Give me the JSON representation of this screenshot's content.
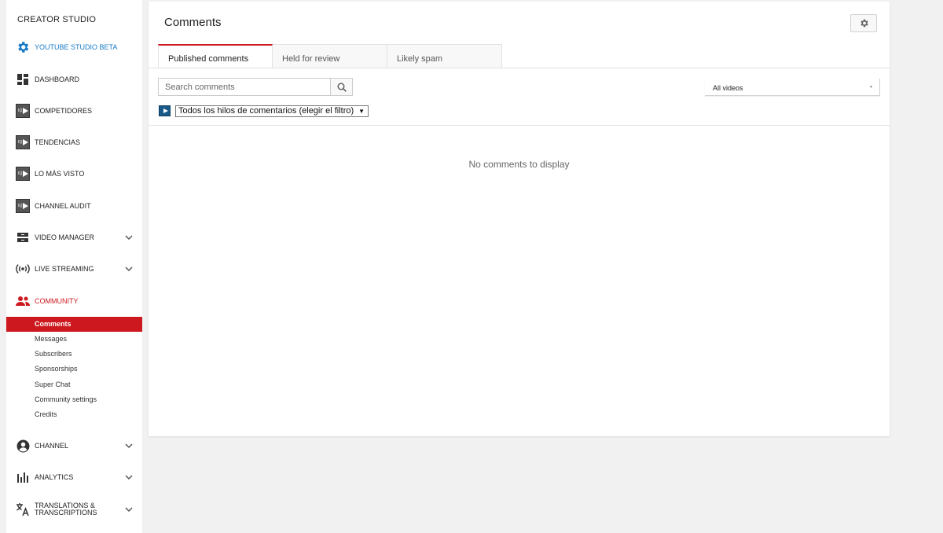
{
  "sidebar": {
    "brand": "CREATOR STUDIO",
    "items": [
      {
        "label": "YOUTUBE STUDIO BETA",
        "icon": "gear-icon"
      },
      {
        "label": "DASHBOARD",
        "icon": "dashboard-icon"
      },
      {
        "label": "COMPETIDORES",
        "icon": "vidiq-icon"
      },
      {
        "label": "TENDENCIAS",
        "icon": "vidiq-icon"
      },
      {
        "label": "LO MÁS VISTO",
        "icon": "vidiq-icon"
      },
      {
        "label": "CHANNEL AUDIT",
        "icon": "vidiq-icon"
      },
      {
        "label": "VIDEO MANAGER",
        "icon": "video-manager-icon"
      },
      {
        "label": "LIVE STREAMING",
        "icon": "live-icon"
      },
      {
        "label": "COMMUNITY",
        "icon": "people-icon"
      },
      {
        "label": "CHANNEL",
        "icon": "account-icon"
      },
      {
        "label": "ANALYTICS",
        "icon": "bar-chart-icon"
      },
      {
        "label": "TRANSLATIONS & TRANSCRIPTIONS",
        "icon": "translate-icon"
      }
    ],
    "community_sub": [
      "Comments",
      "Messages",
      "Subscribers",
      "Sponsorships",
      "Super Chat",
      "Community settings",
      "Credits"
    ]
  },
  "main": {
    "title": "Comments",
    "tabs": [
      "Published comments",
      "Held for review",
      "Likely spam"
    ],
    "search_placeholder": "Search comments",
    "video_filter": "All videos",
    "thread_filter": "Todos los hilos de comentarios (elegir el filtro)",
    "empty_message": "No comments to display"
  },
  "colors": {
    "accent_red": "#cc181e",
    "accent_blue": "#167ac6"
  }
}
